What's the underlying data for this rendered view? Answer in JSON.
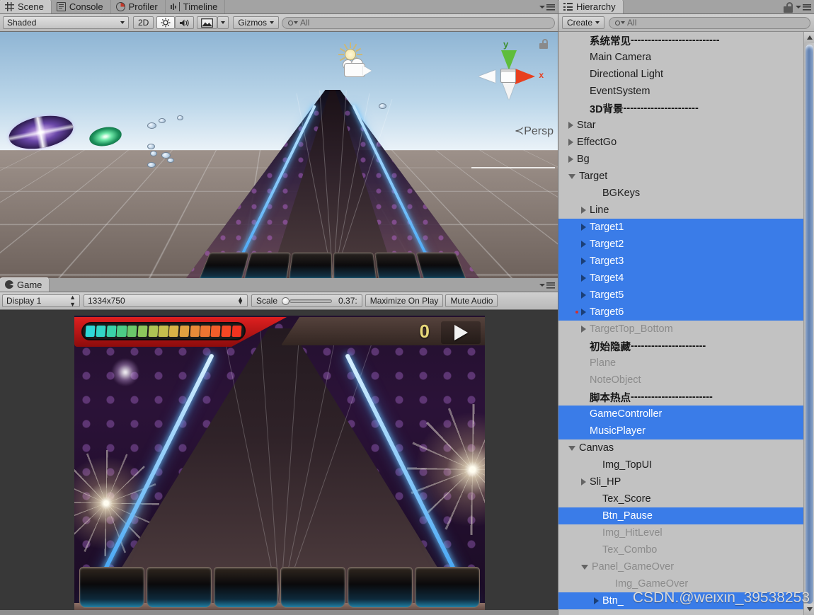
{
  "scene_panel": {
    "tabs": [
      {
        "label": "Scene",
        "icon": "scene-grid-icon",
        "active": true
      },
      {
        "label": "Console",
        "icon": "console-icon",
        "active": false
      },
      {
        "label": "Profiler",
        "icon": "profiler-icon",
        "active": false
      },
      {
        "label": "Timeline",
        "icon": "timeline-icon",
        "active": false
      }
    ],
    "toolbar": {
      "draw_mode": "Shaded",
      "mode_2d": "2D",
      "lighting_icon": "sun-icon",
      "audio_icon": "speaker-icon",
      "effects_icon": "image-icon",
      "gizmos": "Gizmos",
      "search_placeholder": "All",
      "search_value": ""
    },
    "gizmo": {
      "axis_y": "y",
      "axis_x": "x",
      "projection": "Persp",
      "lock_icon": "lock-icon"
    }
  },
  "game_panel": {
    "tabs": [
      {
        "label": "Game",
        "icon": "game-icon",
        "active": true
      }
    ],
    "toolbar": {
      "display": "Display 1",
      "resolution": "1334x750",
      "scale_label": "Scale",
      "scale_value": "0.37:",
      "maximize_on_play": "Maximize On Play",
      "mute_audio": "Mute Audio"
    },
    "hud": {
      "score": "0",
      "pause_icon": "play-triangle-icon",
      "hp_colors": [
        "#2fd8d8",
        "#32d6c6",
        "#3ad2a8",
        "#4ccd86",
        "#6bc96a",
        "#8ec75c",
        "#aec454",
        "#c6bf4d",
        "#d8b246",
        "#e2a03f",
        "#e98a38",
        "#ef7431",
        "#f35d2a",
        "#f64724",
        "#f3331f"
      ]
    }
  },
  "hierarchy": {
    "title": "Hierarchy",
    "tab_icon": "hierarchy-icon",
    "lock_icon": "lock-icon",
    "menu_icon": "panel-menu-icon",
    "create_button": "Create",
    "search_placeholder": "All",
    "search_value": "",
    "items": [
      {
        "label": "系统常见",
        "dashes": "--------------------------",
        "indent": 1,
        "arrow": "none",
        "state": "separator"
      },
      {
        "label": "Main Camera",
        "indent": 1,
        "arrow": "none",
        "state": "normal"
      },
      {
        "label": "Directional Light",
        "indent": 1,
        "arrow": "none",
        "state": "normal"
      },
      {
        "label": "EventSystem",
        "indent": 1,
        "arrow": "none",
        "state": "normal"
      },
      {
        "label": "3D背景",
        "dashes": "----------------------",
        "indent": 1,
        "arrow": "none",
        "state": "separator"
      },
      {
        "label": "Star",
        "indent": 0,
        "arrow": "closed",
        "state": "normal"
      },
      {
        "label": "EffectGo",
        "indent": 0,
        "arrow": "closed",
        "state": "normal"
      },
      {
        "label": "Bg",
        "indent": 0,
        "arrow": "closed",
        "state": "normal"
      },
      {
        "label": "Target",
        "indent": 0,
        "arrow": "open",
        "state": "normal"
      },
      {
        "label": "BGKeys",
        "indent": 2,
        "arrow": "none",
        "state": "normal"
      },
      {
        "label": "Line",
        "indent": 1,
        "arrow": "closed",
        "state": "normal"
      },
      {
        "label": "Target1",
        "indent": 1,
        "arrow": "closed",
        "state": "selected"
      },
      {
        "label": "Target2",
        "indent": 1,
        "arrow": "closed",
        "state": "selected"
      },
      {
        "label": "Target3",
        "indent": 1,
        "arrow": "closed",
        "state": "selected"
      },
      {
        "label": "Target4",
        "indent": 1,
        "arrow": "closed",
        "state": "selected"
      },
      {
        "label": "Target5",
        "indent": 1,
        "arrow": "closed",
        "state": "selected"
      },
      {
        "label": "Target6",
        "indent": 1,
        "arrow": "closed",
        "state": "selected",
        "marker": true
      },
      {
        "label": "TargetTop_Bottom",
        "indent": 1,
        "arrow": "closed",
        "state": "inactive"
      },
      {
        "label": "初始隐藏",
        "dashes": "----------------------",
        "indent": 1,
        "arrow": "none",
        "state": "separator"
      },
      {
        "label": "Plane",
        "indent": 1,
        "arrow": "none",
        "state": "inactive"
      },
      {
        "label": "NoteObject",
        "indent": 1,
        "arrow": "none",
        "state": "inactive"
      },
      {
        "label": "脚本热点",
        "dashes": "------------------------",
        "indent": 1,
        "arrow": "none",
        "state": "separator"
      },
      {
        "label": "GameController",
        "indent": 1,
        "arrow": "none",
        "state": "selected"
      },
      {
        "label": "MusicPlayer",
        "indent": 1,
        "arrow": "none",
        "state": "selected"
      },
      {
        "label": "Canvas",
        "indent": 0,
        "arrow": "open",
        "state": "normal"
      },
      {
        "label": "Img_TopUI",
        "indent": 2,
        "arrow": "none",
        "state": "normal"
      },
      {
        "label": "Sli_HP",
        "indent": 1,
        "arrow": "closed",
        "state": "normal"
      },
      {
        "label": "Tex_Score",
        "indent": 2,
        "arrow": "none",
        "state": "normal"
      },
      {
        "label": "Btn_Pause",
        "indent": 2,
        "arrow": "none",
        "state": "selected"
      },
      {
        "label": "Img_HitLevel",
        "indent": 2,
        "arrow": "none",
        "state": "inactive"
      },
      {
        "label": "Tex_Combo",
        "indent": 2,
        "arrow": "none",
        "state": "inactive"
      },
      {
        "label": "Panel_GameOver",
        "indent": 1,
        "arrow": "open",
        "state": "inactive"
      },
      {
        "label": "Img_GameOver",
        "indent": 3,
        "arrow": "none",
        "state": "inactive"
      },
      {
        "label": "Btn_",
        "indent": 2,
        "arrow": "closed",
        "state": "selected"
      }
    ]
  },
  "watermark": "CSDN.@weixin_39538253",
  "colors": {
    "selection_blue": "#3a7ce8",
    "panel_bg": "#c2c2c2",
    "toolbar_bg": "#cfcfcf",
    "tab_active": "#c8c8c8",
    "inactive_text": "#8b8b8b"
  }
}
